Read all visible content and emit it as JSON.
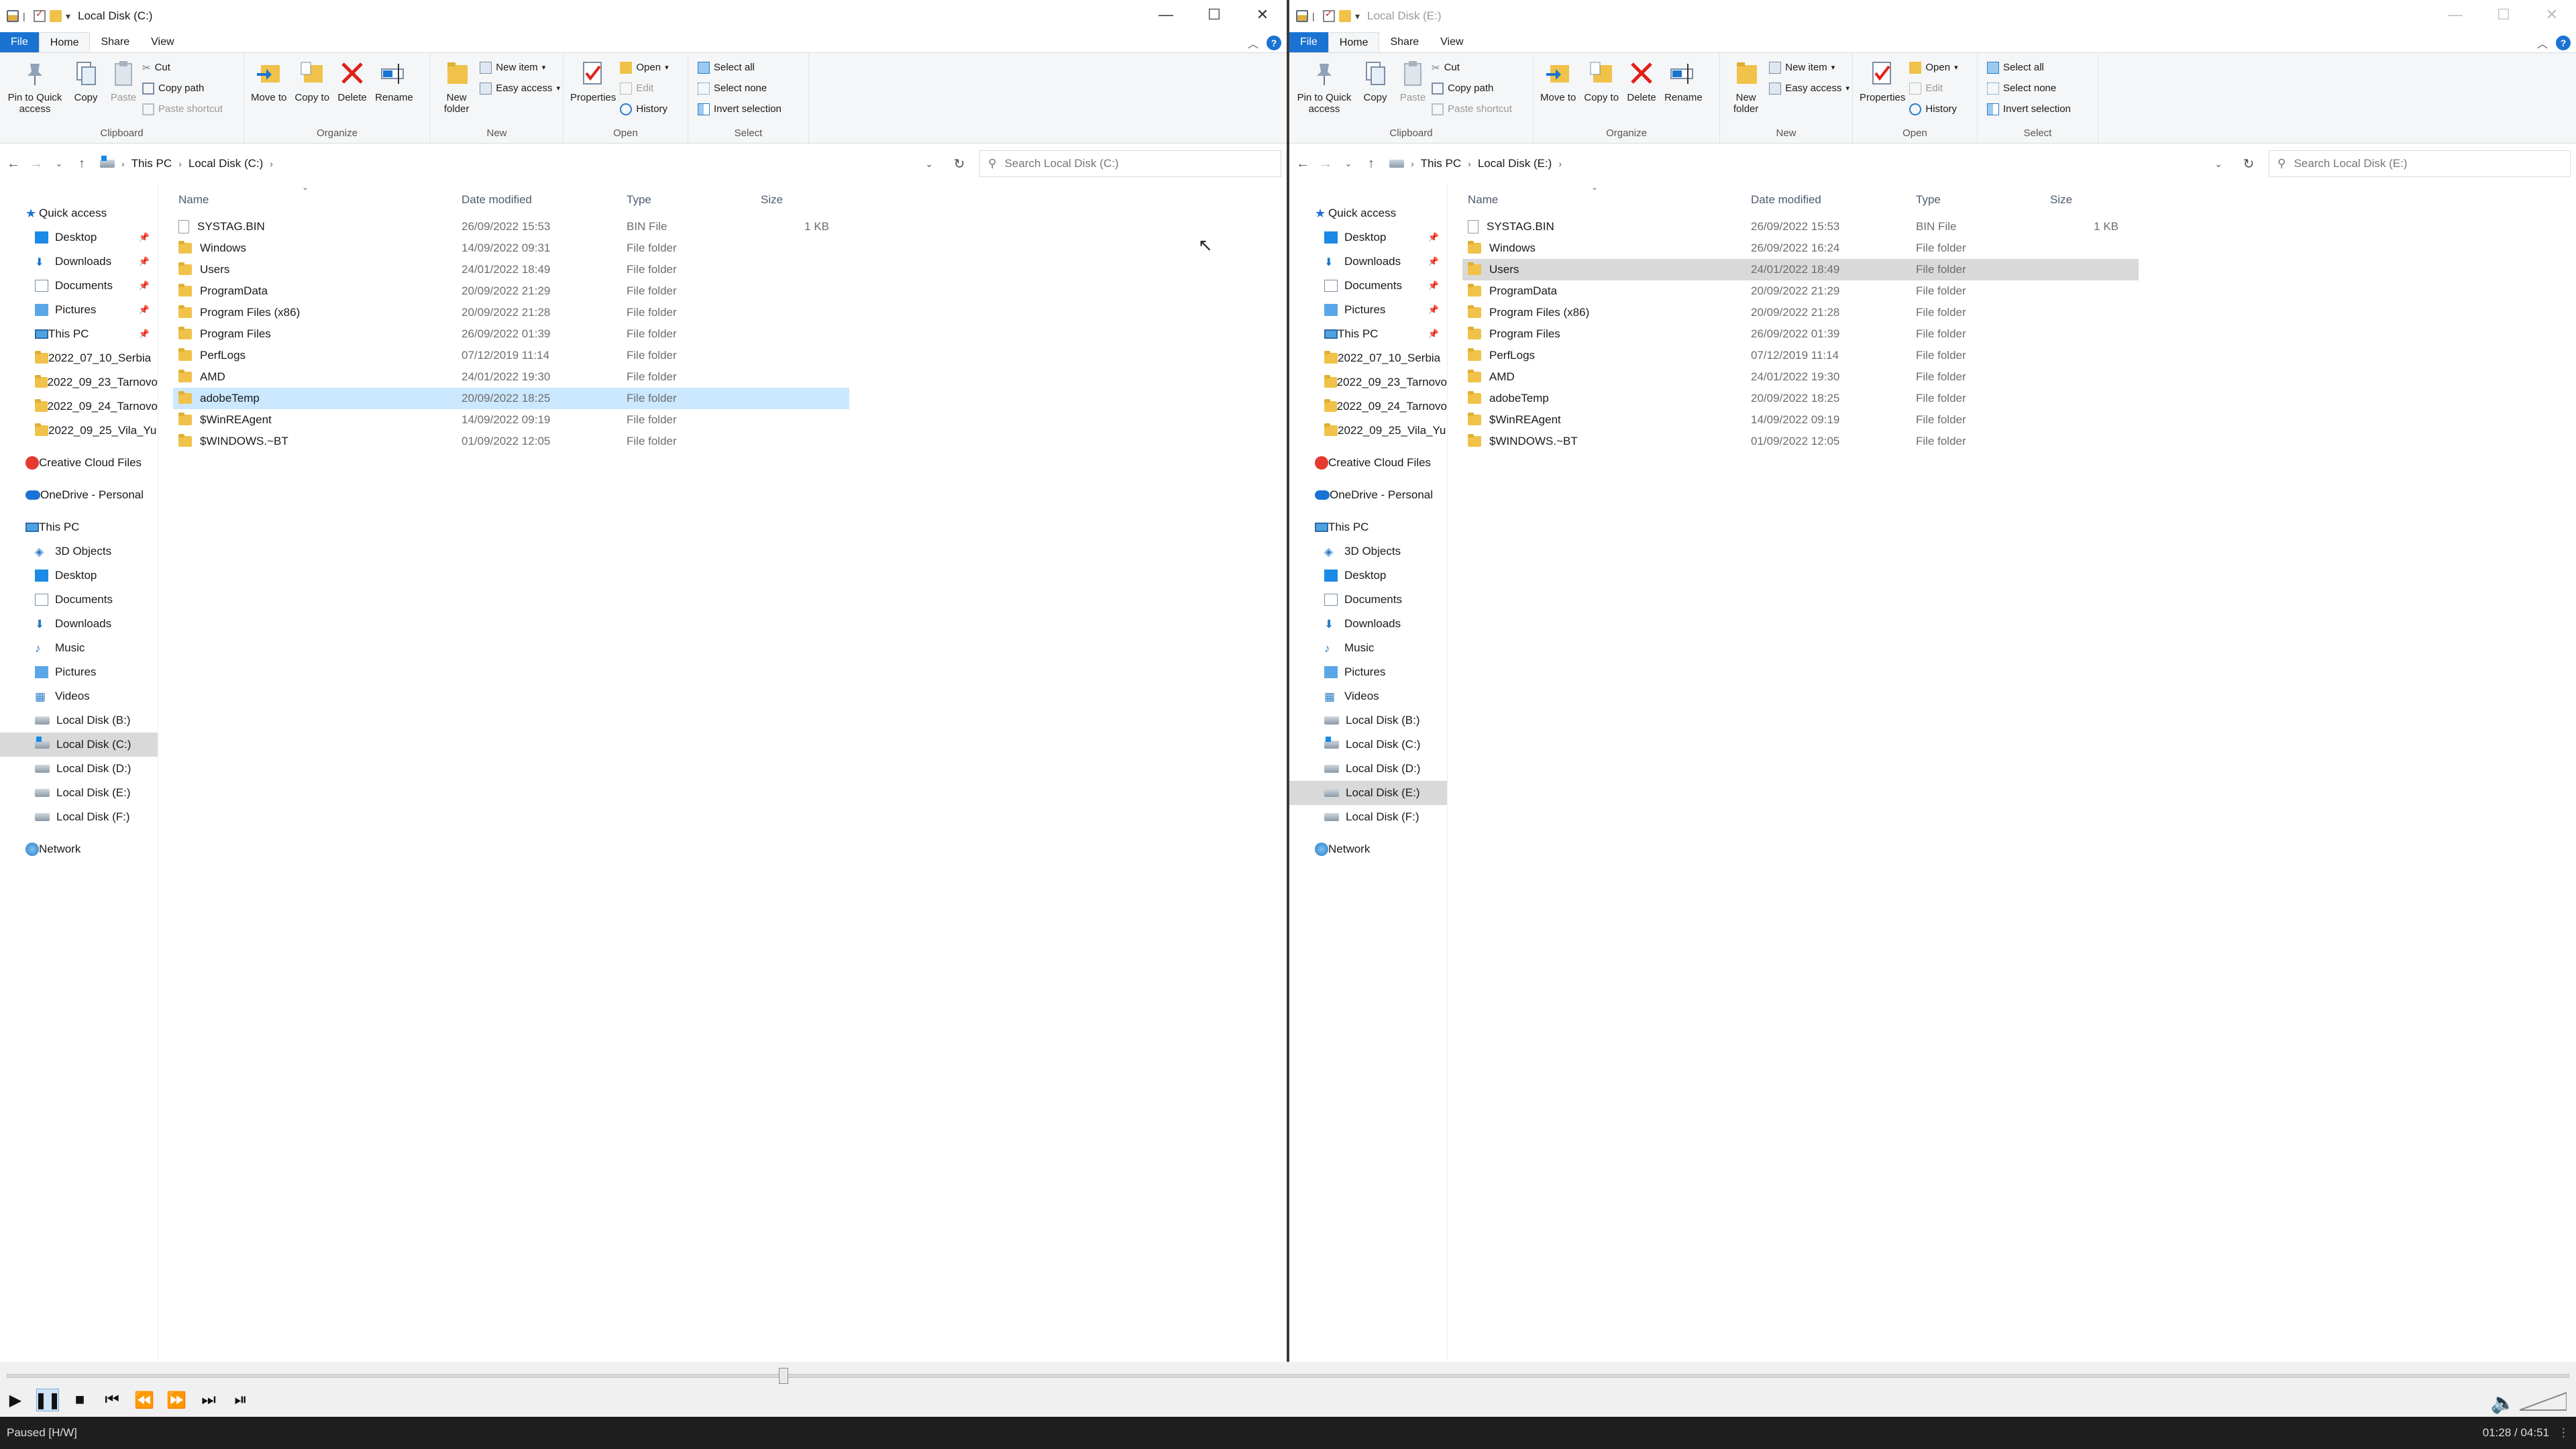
{
  "ribbon": {
    "tabs": [
      "File",
      "Home",
      "Share",
      "View"
    ],
    "groups": {
      "clipboard": "Clipboard",
      "organize": "Organize",
      "new": "New",
      "open": "Open",
      "select": "Select"
    },
    "pin": "Pin to Quick access",
    "copy": "Copy",
    "paste": "Paste",
    "cut": "Cut",
    "copy_path": "Copy path",
    "paste_shortcut": "Paste shortcut",
    "move_to": "Move to",
    "copy_to": "Copy to",
    "delete": "Delete",
    "rename": "Rename",
    "new_folder": "New folder",
    "new_item": "New item",
    "easy_access": "Easy access",
    "properties": "Properties",
    "open": "Open",
    "edit": "Edit",
    "history": "History",
    "select_all": "Select all",
    "select_none": "Select none",
    "invert_selection": "Invert selection"
  },
  "columns": {
    "name": "Name",
    "date": "Date modified",
    "type": "Type",
    "size": "Size"
  },
  "sidebar": {
    "quick_access": "Quick access",
    "quick_items": [
      "Desktop",
      "Downloads",
      "Documents",
      "Pictures",
      "This PC",
      "2022_07_10_Serbia",
      "2022_09_23_Tarnovo",
      "2022_09_24_Tarnovo",
      "2022_09_25_Vila_Yu"
    ],
    "creative_cloud": "Creative Cloud Files",
    "onedrive": "OneDrive - Personal",
    "this_pc": "This PC",
    "pc_items": [
      "3D Objects",
      "Desktop",
      "Documents",
      "Downloads",
      "Music",
      "Pictures",
      "Videos"
    ],
    "drives": [
      "Local Disk (B:)",
      "Local Disk (C:)",
      "Local Disk (D:)",
      "Local Disk (E:)",
      "Local Disk (F:)"
    ],
    "network": "Network"
  },
  "left": {
    "title": "Local Disk (C:)",
    "crumbs": [
      "This PC",
      "Local Disk (C:)"
    ],
    "search_placeholder": "Search Local Disk (C:)",
    "files": [
      {
        "name": "SYSTAG.BIN",
        "date": "26/09/2022 15:53",
        "type": "BIN File",
        "size": "1 KB"
      },
      {
        "name": "Windows",
        "date": "14/09/2022 09:31",
        "type": "File folder",
        "size": ""
      },
      {
        "name": "Users",
        "date": "24/01/2022 18:49",
        "type": "File folder",
        "size": ""
      },
      {
        "name": "ProgramData",
        "date": "20/09/2022 21:29",
        "type": "File folder",
        "size": ""
      },
      {
        "name": "Program Files (x86)",
        "date": "20/09/2022 21:28",
        "type": "File folder",
        "size": ""
      },
      {
        "name": "Program Files",
        "date": "26/09/2022 01:39",
        "type": "File folder",
        "size": ""
      },
      {
        "name": "PerfLogs",
        "date": "07/12/2019 11:14",
        "type": "File folder",
        "size": ""
      },
      {
        "name": "AMD",
        "date": "24/01/2022 19:30",
        "type": "File folder",
        "size": ""
      },
      {
        "name": "adobeTemp",
        "date": "20/09/2022 18:25",
        "type": "File folder",
        "size": ""
      },
      {
        "name": "$WinREAgent",
        "date": "14/09/2022 09:19",
        "type": "File folder",
        "size": ""
      },
      {
        "name": "$WINDOWS.~BT",
        "date": "01/09/2022 12:05",
        "type": "File folder",
        "size": ""
      }
    ]
  },
  "right": {
    "title": "Local Disk (E:)",
    "crumbs": [
      "This PC",
      "Local Disk (E:)"
    ],
    "search_placeholder": "Search Local Disk (E:)",
    "files": [
      {
        "name": "SYSTAG.BIN",
        "date": "26/09/2022 15:53",
        "type": "BIN File",
        "size": "1 KB"
      },
      {
        "name": "Windows",
        "date": "26/09/2022 16:24",
        "type": "File folder",
        "size": ""
      },
      {
        "name": "Users",
        "date": "24/01/2022 18:49",
        "type": "File folder",
        "size": ""
      },
      {
        "name": "ProgramData",
        "date": "20/09/2022 21:29",
        "type": "File folder",
        "size": ""
      },
      {
        "name": "Program Files (x86)",
        "date": "20/09/2022 21:28",
        "type": "File folder",
        "size": ""
      },
      {
        "name": "Program Files",
        "date": "26/09/2022 01:39",
        "type": "File folder",
        "size": ""
      },
      {
        "name": "PerfLogs",
        "date": "07/12/2019 11:14",
        "type": "File folder",
        "size": ""
      },
      {
        "name": "AMD",
        "date": "24/01/2022 19:30",
        "type": "File folder",
        "size": ""
      },
      {
        "name": "adobeTemp",
        "date": "20/09/2022 18:25",
        "type": "File folder",
        "size": ""
      },
      {
        "name": "$WinREAgent",
        "date": "14/09/2022 09:19",
        "type": "File folder",
        "size": ""
      },
      {
        "name": "$WINDOWS.~BT",
        "date": "01/09/2022 12:05",
        "type": "File folder",
        "size": ""
      }
    ]
  },
  "player": {
    "status": "Paused [H/W]",
    "time": "01:28 / 04:51",
    "progress": 0.303
  },
  "colors": {
    "accent": "#1a73d2",
    "selection": "#cce8ff",
    "inactive_selection": "#d9d9d9"
  }
}
